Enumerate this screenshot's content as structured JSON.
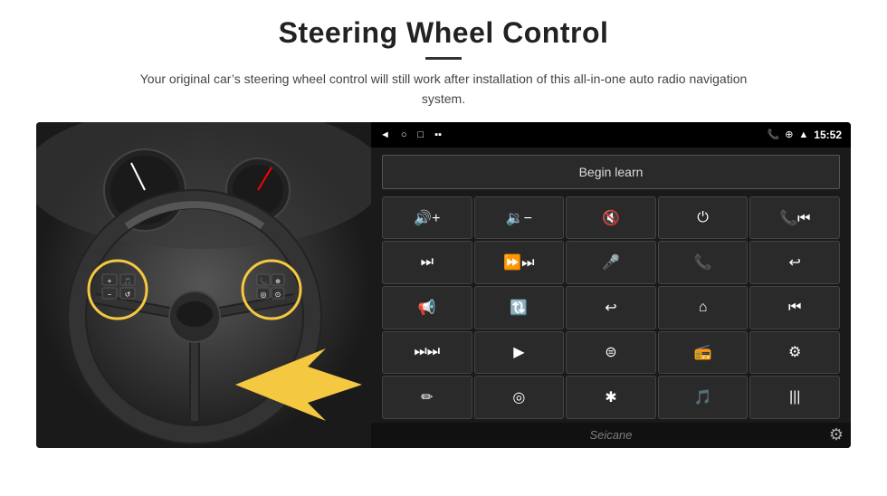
{
  "header": {
    "title": "Steering Wheel Control",
    "subtitle": "Your original car’s steering wheel control will still work after installation of this all-in-one auto radio navigation system."
  },
  "status_bar": {
    "time": "15:52",
    "left_icons": [
      "◄",
      "□",
      "□"
    ],
    "right_icons": [
      "☎",
      "⌖",
      "♥"
    ]
  },
  "begin_learn_label": "Begin learn",
  "control_buttons": [
    {
      "icon": "🔊+",
      "unicode": "🔊",
      "label": "vol-up"
    },
    {
      "icon": "🔉−",
      "unicode": "🔉",
      "label": "vol-down"
    },
    {
      "icon": "🔇",
      "unicode": "🔇",
      "label": "mute"
    },
    {
      "icon": "⏻",
      "unicode": "⏻",
      "label": "power"
    },
    {
      "icon": "📞⏮",
      "unicode": "📞⏮",
      "label": "call-prev"
    },
    {
      "icon": "⏭",
      "unicode": "⏭",
      "label": "next-track"
    },
    {
      "icon": "🎵⏭",
      "unicode": "⏭",
      "label": "fast-forward"
    },
    {
      "icon": "🎤",
      "unicode": "🎤",
      "label": "mic"
    },
    {
      "icon": "☎",
      "unicode": "📞",
      "label": "call"
    },
    {
      "icon": "☇",
      "unicode": "↩",
      "label": "hang-up"
    },
    {
      "icon": "🔔",
      "unicode": "🔔",
      "label": "horn"
    },
    {
      "icon": "↺",
      "unicode": "🔃",
      "label": "360"
    },
    {
      "icon": "↩",
      "unicode": "↩",
      "label": "back"
    },
    {
      "icon": "⌂",
      "unicode": "⌂",
      "label": "home"
    },
    {
      "icon": "⏮⏮",
      "unicode": "⏮",
      "label": "prev-track"
    },
    {
      "icon": "⏭⏭",
      "unicode": "⏭",
      "label": "skip-fwd"
    },
    {
      "icon": "▶",
      "unicode": "▶",
      "label": "play"
    },
    {
      "icon": "⦿",
      "unicode": "⦿",
      "label": "source"
    },
    {
      "icon": "📻",
      "unicode": "📻",
      "label": "radio"
    },
    {
      "icon": "⦀",
      "unicode": "⚙",
      "label": "eq"
    },
    {
      "icon": "✏",
      "unicode": "✏",
      "label": "edit"
    },
    {
      "icon": "◎",
      "unicode": "◎",
      "label": "navi"
    },
    {
      "icon": "★",
      "unicode": "★",
      "label": "bt"
    },
    {
      "icon": "🎵⚙",
      "unicode": "🎵",
      "label": "music-settings"
    },
    {
      "icon": "⦀⦀",
      "unicode": "⚙",
      "label": "sound-bars"
    }
  ],
  "watermark": "Seicane",
  "icons": {
    "gear": "⚙"
  }
}
